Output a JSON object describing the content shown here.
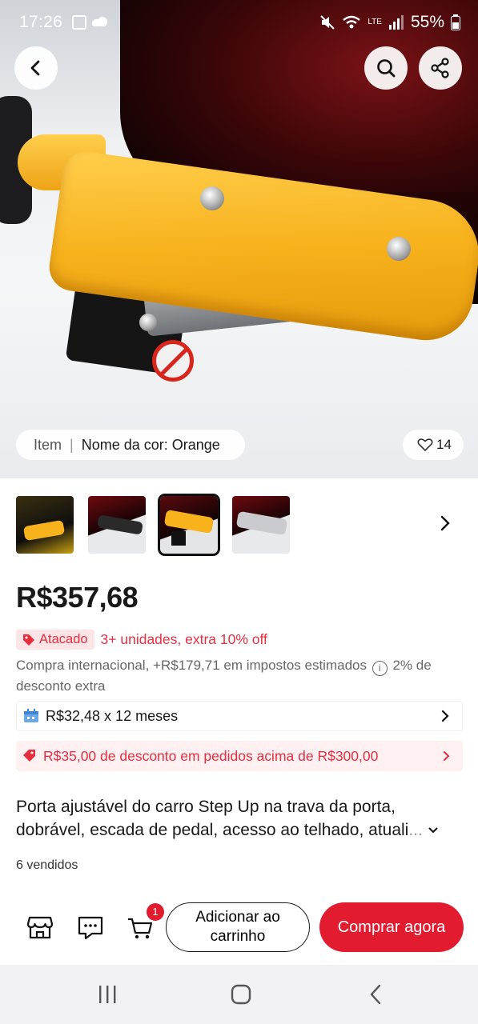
{
  "status_bar": {
    "time": "17:26",
    "battery": "55%",
    "network": "LTE"
  },
  "hero": {
    "variant_label": "Item",
    "color_label": "Nome da cor: Orange",
    "likes": "14",
    "icons": [
      "back-arrow-icon",
      "search-icon",
      "share-icon",
      "heart-icon"
    ]
  },
  "thumbnails": {
    "count": 4,
    "selected_index": 2
  },
  "price": "R$357,68",
  "wholesale": {
    "tag": "Atacado",
    "text": "3+ unidades, extra 10% off"
  },
  "international": {
    "text_before": "Compra internacional, +R$179,71 em impostos estimados",
    "text_after": "2% de desconto extra",
    "info": "i"
  },
  "installments": {
    "text": "R$32,48 x 12 meses"
  },
  "discount": {
    "text": "R$35,00 de desconto em pedidos acima de R$300,00"
  },
  "product": {
    "title": "Porta ajustável do carro Step Up na trava da porta, dobrável, escada de pedal, acesso ao telhado, atuali",
    "title_fade": "...",
    "sold": "6 vendidos"
  },
  "actions": {
    "cart_badge": "1",
    "add_to_cart": "Adicionar ao carrinho",
    "buy_now": "Comprar agora"
  },
  "colors": {
    "accent": "#e21b2f",
    "promo_red": "#e62e3f",
    "pedal_orange": "#f7b21c"
  }
}
